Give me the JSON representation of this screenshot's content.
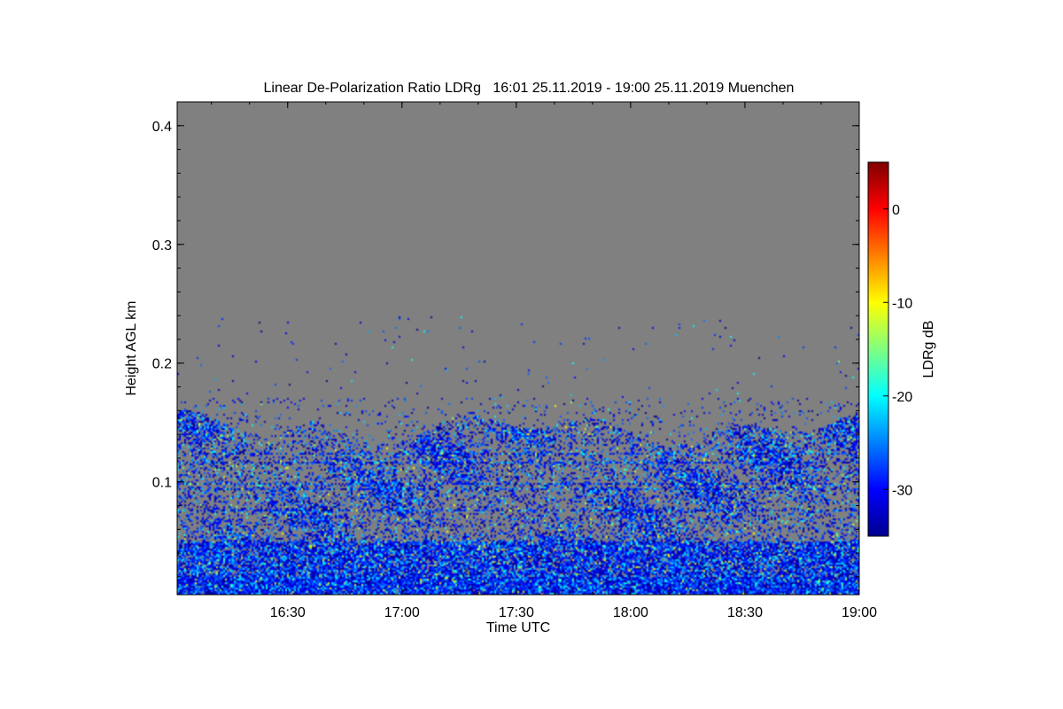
{
  "chart_data": {
    "type": "heatmap",
    "title": "Linear De-Polarization Ratio LDRg   16:01 25.11.2019 - 19:00 25.11.2019 Muenchen",
    "xlabel": "Time UTC",
    "ylabel": "Height AGL km",
    "colorbar_label": "LDRg dB",
    "x_range": [
      "16:01",
      "19:00"
    ],
    "x_ticks": [
      "16:30",
      "17:00",
      "17:30",
      "18:00",
      "18:30",
      "19:00"
    ],
    "y_range": [
      0.005,
      0.42
    ],
    "y_ticks": [
      0.1,
      0.2,
      0.3,
      0.4
    ],
    "y_tick_labels": [
      "0.1",
      "0.2",
      "0.3",
      "0.4"
    ],
    "colorbar_range": [
      -35,
      5
    ],
    "colorbar_ticks": [
      0,
      -10,
      -20,
      -30
    ],
    "colorbar_tick_labels": [
      "0",
      "-10",
      "-20",
      "-30"
    ],
    "no_data_color": "#808080",
    "background_color": "#ffffff",
    "colormap": "jet",
    "signal_field": {
      "typical_top_km": [
        0.13,
        0.16
      ],
      "dominant_range_db": [
        -35,
        -25
      ],
      "sparse_features_km": [
        0.17,
        0.24
      ]
    }
  }
}
